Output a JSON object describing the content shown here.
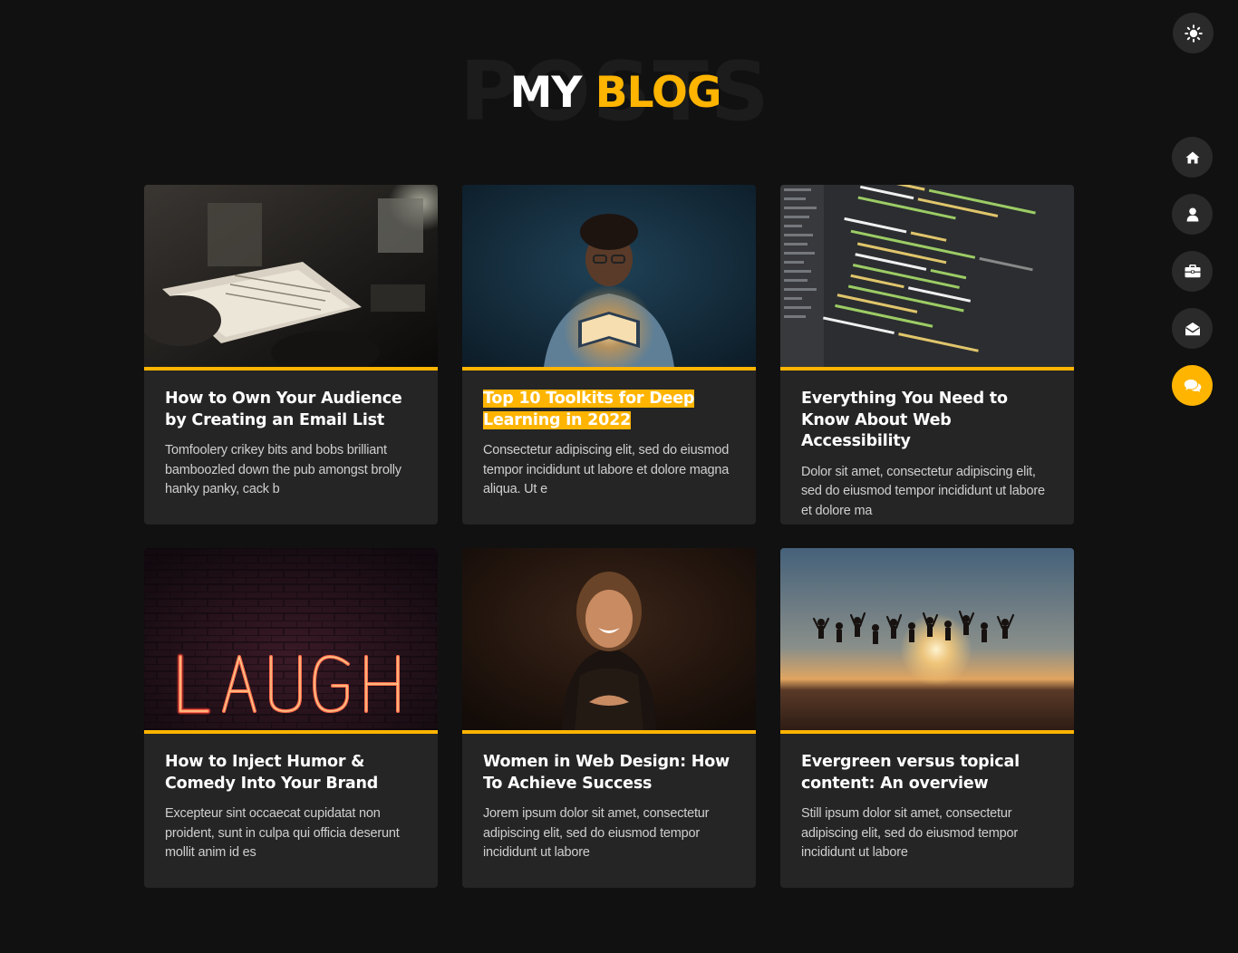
{
  "header": {
    "background_word": "POSTS",
    "title_part1": "MY",
    "title_part2": "BLOG"
  },
  "theme_toggle": {
    "icon": "sun-icon"
  },
  "nav": [
    {
      "icon": "home-icon",
      "active": false
    },
    {
      "icon": "user-icon",
      "active": false
    },
    {
      "icon": "briefcase-icon",
      "active": false
    },
    {
      "icon": "envelope-open-icon",
      "active": false
    },
    {
      "icon": "comments-icon",
      "active": true
    }
  ],
  "colors": {
    "accent": "#ffb400",
    "background": "#111111",
    "card": "#252525",
    "nav_button": "#2b2a2a"
  },
  "posts": [
    {
      "title": "How to Own Your Audience by Creating an Email List",
      "excerpt": "Tomfoolery crikey bits and bobs brilliant bamboozled down the pub amongst brolly hanky panky, cack b",
      "image": "desk-with-notebook-photo",
      "highlighted": false
    },
    {
      "title": "Top 10 Toolkits for Deep Learning in 2022",
      "excerpt": "Consectetur adipiscing elit, sed do eiusmod tempor incididunt ut labore et dolore magna aliqua. Ut e",
      "image": "man-reading-glowing-book-photo",
      "highlighted": true
    },
    {
      "title": "Everything You Need to Know About Web Accessibility",
      "excerpt": "Dolor sit amet, consectetur adipiscing elit, sed do eiusmod tempor incididunt ut labore et dolore ma",
      "image": "code-editor-photo",
      "highlighted": false
    },
    {
      "title": "How to Inject Humor & Comedy Into Your Brand",
      "excerpt": "Excepteur sint occaecat cupidatat non proident, sunt in culpa qui officia deserunt mollit anim id es",
      "image": "laugh-neon-sign-photo",
      "highlighted": false
    },
    {
      "title": "Women in Web Design: How To Achieve Success",
      "excerpt": "Jorem ipsum dolor sit amet, consectetur adipiscing elit, sed do eiusmod tempor incididunt ut labore",
      "image": "laughing-woman-photo",
      "highlighted": false
    },
    {
      "title": "Evergreen versus topical content: An overview",
      "excerpt": "Still ipsum dolor sit amet, consectetur adipiscing elit, sed do eiusmod tempor incididunt ut labore",
      "image": "people-jumping-sunset-photo",
      "highlighted": false
    }
  ]
}
